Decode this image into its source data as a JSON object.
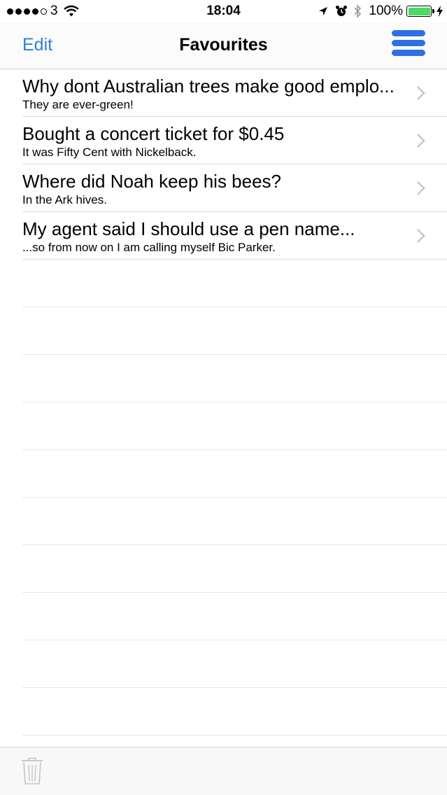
{
  "status_bar": {
    "carrier": "3",
    "time": "18:04",
    "battery_percent": "100%",
    "battery_level": 1.0,
    "signal_bars_filled": 4,
    "signal_bars_total": 5
  },
  "nav": {
    "edit_label": "Edit",
    "title": "Favourites",
    "accent_color": "#2f7fe0",
    "menu_icon": "hamburger-menu-icon"
  },
  "jokes": [
    {
      "title": "Why dont Australian trees make good emplo...",
      "subtitle": "They are ever-green!"
    },
    {
      "title": "Bought a concert ticket for $0.45",
      "subtitle": "It was Fifty Cent with Nickelback."
    },
    {
      "title": "Where did Noah keep his bees?",
      "subtitle": "In the Ark hives."
    },
    {
      "title": "My agent said I should use a pen name...",
      "subtitle": "...so from now on I am calling myself Bic Parker."
    }
  ],
  "toolbar": {
    "trash_icon": "trash-icon"
  }
}
